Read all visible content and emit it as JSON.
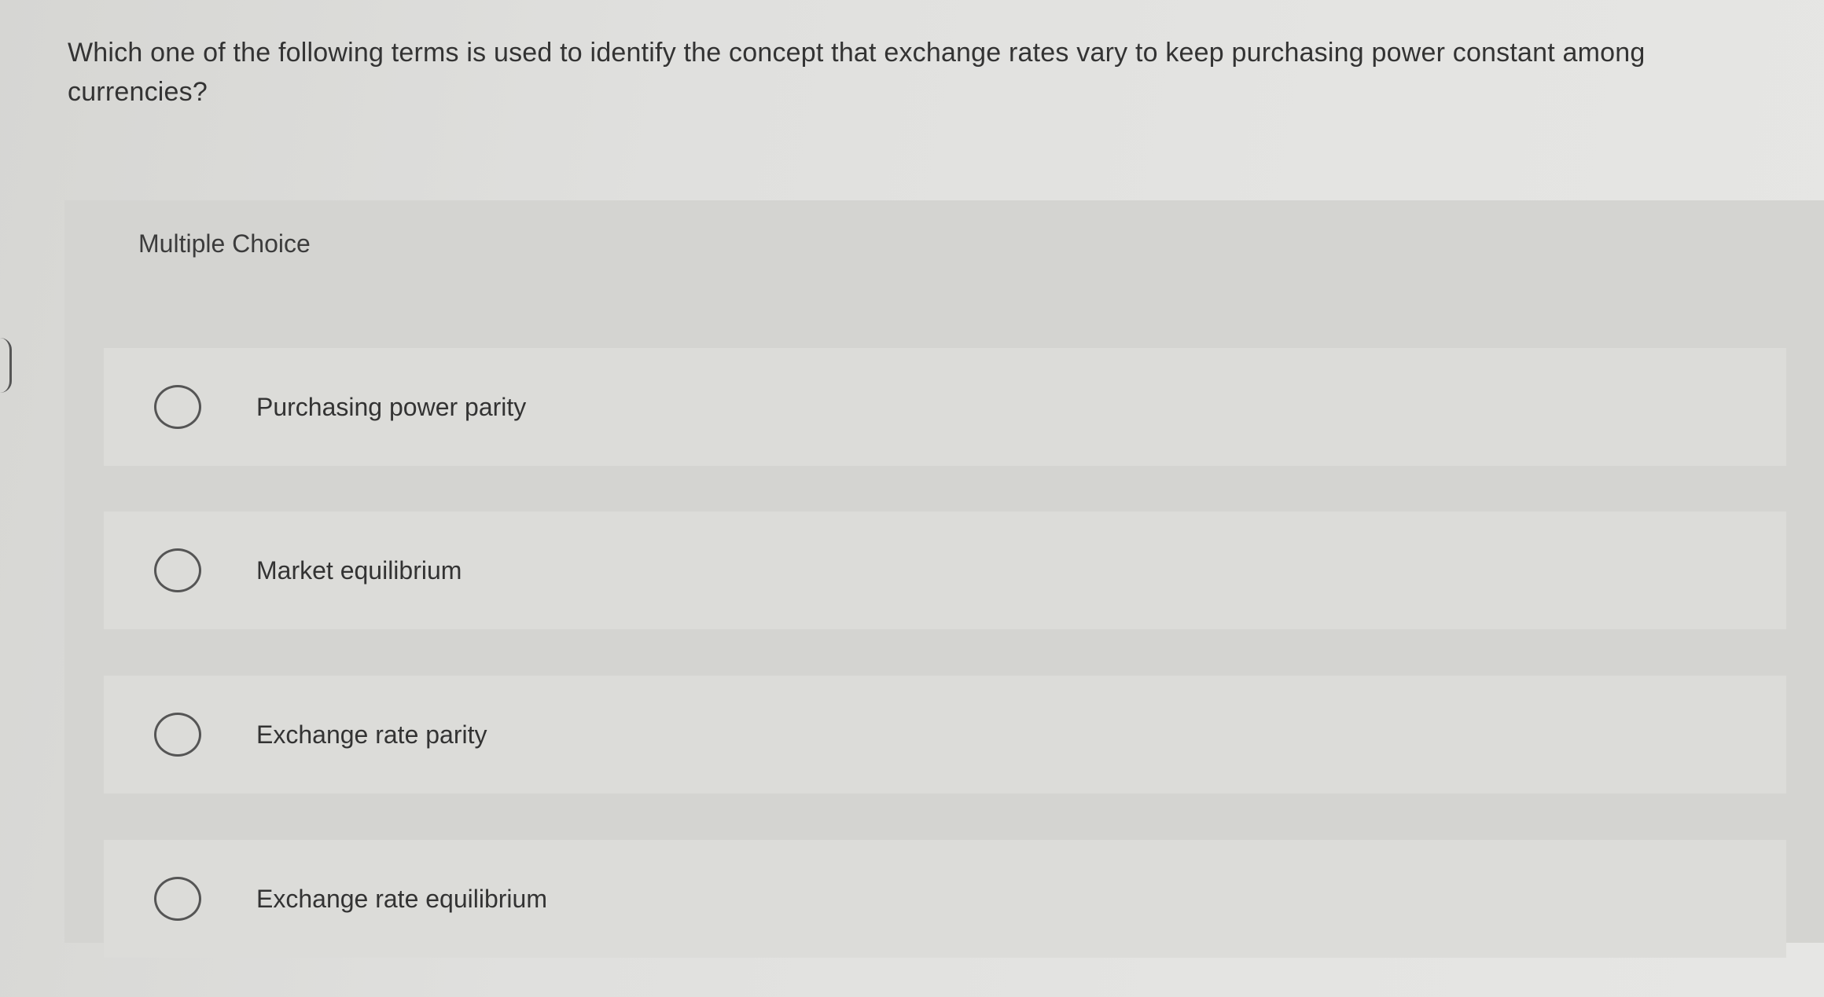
{
  "question": {
    "text": "Which one of the following terms is used to identify the concept that exchange rates vary to keep purchasing power constant among currencies?"
  },
  "choices": {
    "section_label": "Multiple Choice",
    "options": [
      {
        "label": "Purchasing power parity"
      },
      {
        "label": "Market equilibrium"
      },
      {
        "label": "Exchange rate parity"
      },
      {
        "label": "Exchange rate equilibrium"
      }
    ]
  }
}
